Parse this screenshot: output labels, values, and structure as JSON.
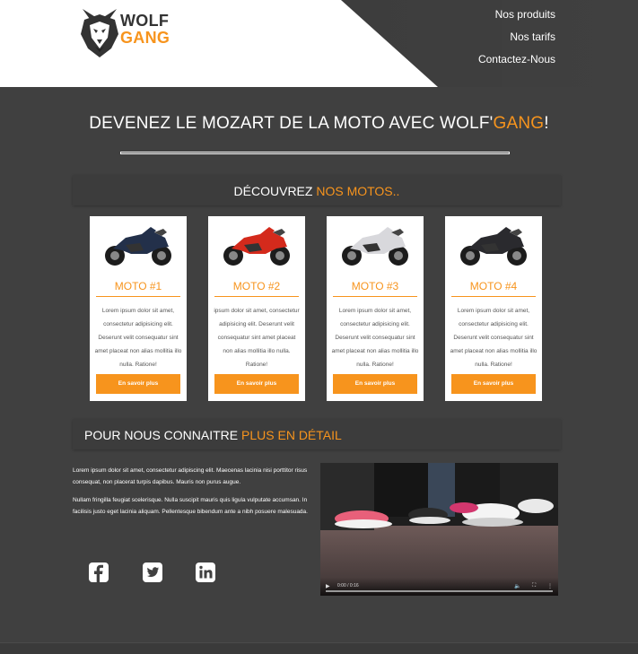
{
  "brand": {
    "line1": "WOLF",
    "line2": "GANG",
    "accent": "#f7941d",
    "icon": "wolf-head-icon"
  },
  "nav": {
    "items": [
      "Nos produits",
      "Nos tarifs",
      "Contactez-Nous"
    ]
  },
  "hero": {
    "title_before": "DEVENEZ LE MOZART DE LA MOTO AVEC WOLF'",
    "title_highlight": "GANG",
    "title_after": "!"
  },
  "motos_section": {
    "label": "DÉCOUVREZ ",
    "highlight": "NOS MOTOS.."
  },
  "cards": [
    {
      "title": "MOTO #1",
      "text": "Lorem ipsum dolor sit amet, consectetur adipisicing elit. Deserunt velit consequatur sint amet placeat non alias mollitia illo nulla. Ratione!",
      "button": "En savoir plus",
      "bike_color": "#23304a"
    },
    {
      "title": "MOTO #2",
      "text": "ipsum dolor sit amet, consectetur adipisicing elit. Deserunt velit consequatur sint amet placeat non alias mollitia illo nulla. Ratione!",
      "button": "En savoir plus",
      "bike_color": "#d42a1c"
    },
    {
      "title": "MOTO #3",
      "text": "Lorem ipsum dolor sit amet, consectetur adipisicing elit. Deserunt velit consequatur sint amet placeat non alias mollitia illo nulla. Ratione!",
      "button": "En savoir plus",
      "bike_color": "#d8d8dc"
    },
    {
      "title": "MOTO #4",
      "text": "Lorem ipsum dolor sit amet, consectetur adipisicing elit. Deserunt velit consequatur sint amet placeat non alias mollitia illo nulla. Ratione!",
      "button": "En savoir plus",
      "bike_color": "#2a2a2e"
    }
  ],
  "about_section": {
    "label": "POUR NOUS CONNAITRE ",
    "highlight": "PLUS EN DÉTAIL"
  },
  "about": {
    "p1": "Lorem ipsum dolor sit amet, consectetur adipiscing elit. Maecenas lacinia nisi porttitor risus consequat, non placerat turpis dapibus. Mauris non purus augue.",
    "p2": "Nullam fringilla feugiat scelerisque. Nulla suscipit mauris quis ligula vulputate accumsan. In facilisis justo eget lacinia aliquam. Pellentesque bibendum ante a nibh posuere malesuada."
  },
  "social": [
    "facebook-icon",
    "twitter-icon",
    "linkedin-icon"
  ],
  "video": {
    "time": "0:00 / 0:16",
    "progress": 0
  }
}
